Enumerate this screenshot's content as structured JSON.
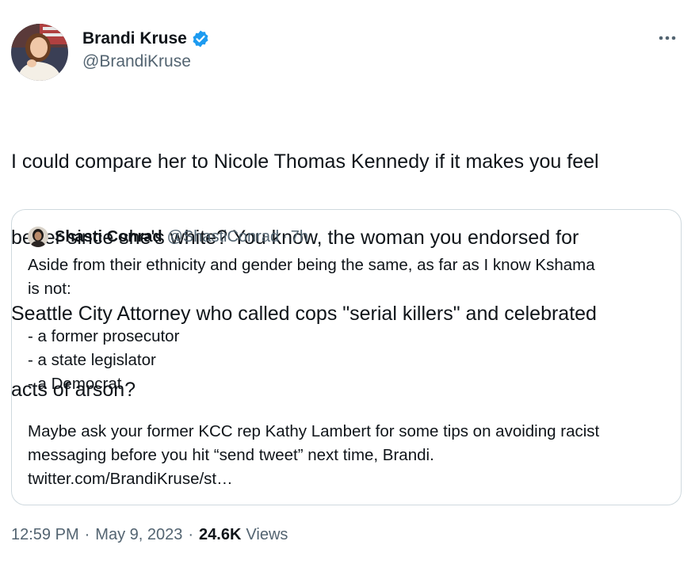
{
  "author": {
    "display_name": "Brandi Kruse",
    "handle": "@BrandiKruse",
    "verified_icon": "verified-badge-icon",
    "verified_color": "#1d9bf0"
  },
  "tweet": {
    "text_lines": [
      "I could compare her to Nicole Thomas Kennedy if it makes you feel",
      "better since she's white? You know, the woman you endorsed for",
      "Seattle City Attorney who called cops \"serial killers\" and celebrated",
      "acts of arson?"
    ]
  },
  "quote": {
    "display_name": "Shasti Conrad",
    "handle": "@ShastiConrad",
    "separator": "·",
    "time": "7h",
    "lines": [
      "Aside from their ethnicity and gender being the same, as far as I know Kshama",
      "is not:",
      "",
      "- a former prosecutor",
      "- a state legislator",
      "- a Democrat",
      "",
      "Maybe ask your former KCC rep Kathy Lambert for some tips on avoiding racist",
      "messaging before you hit “send tweet” next time, Brandi.",
      "twitter.com/BrandiKruse/st…"
    ]
  },
  "meta": {
    "time": "12:59 PM",
    "dot1": "·",
    "date": "May 9, 2023",
    "dot2": "·",
    "views_count": "24.6K",
    "views_label": "Views"
  },
  "colors": {
    "text_primary": "#0f1419",
    "text_secondary": "#536471",
    "border": "#cfd9de",
    "verified": "#1d9bf0"
  }
}
